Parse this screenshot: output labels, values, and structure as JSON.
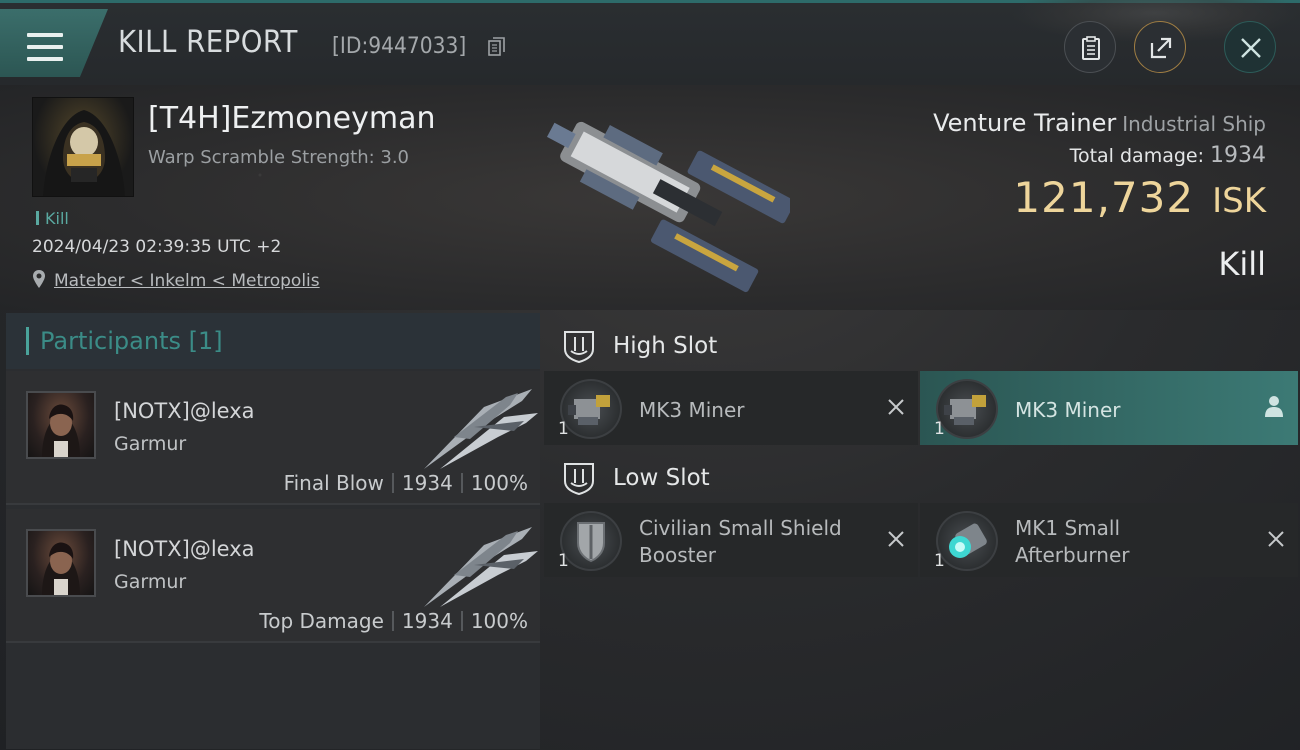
{
  "header": {
    "title": "KILL REPORT",
    "report_id": "[ID:9447033]"
  },
  "victim": {
    "name": "[T4H]Ezmoneyman",
    "warp_scramble": "Warp Scramble Strength: 3.0",
    "tag": "Kill",
    "datetime": "2024/04/23 02:39:35 UTC +2",
    "location": "Mateber < Inkelm < Metropolis",
    "ship_name": "Venture Trainer",
    "ship_class": "Industrial Ship",
    "total_damage_label": "Total damage:",
    "total_damage": "1934",
    "isk_value": "121,732",
    "isk_currency": "ISK",
    "result": "Kill"
  },
  "participants": {
    "title": "Participants [1]",
    "items": [
      {
        "name": "[NOTX]@lexa",
        "ship": "Garmur",
        "role": "Final Blow",
        "damage": "1934",
        "percent": "100%"
      },
      {
        "name": "[NOTX]@lexa",
        "ship": "Garmur",
        "role": "Top Damage",
        "damage": "1934",
        "percent": "100%"
      }
    ]
  },
  "fitting": {
    "high_slot": {
      "label": "High Slot",
      "modules": [
        {
          "name": "MK3 Miner",
          "qty": "1"
        },
        {
          "name": "MK3 Miner",
          "qty": "1"
        }
      ]
    },
    "low_slot": {
      "label": "Low Slot",
      "modules": [
        {
          "name_line1": "Civilian Small Shield",
          "name_line2": "Booster",
          "qty": "1"
        },
        {
          "name_line1": "MK1 Small",
          "name_line2": "Afterburner",
          "qty": "1"
        }
      ]
    }
  },
  "colors": {
    "accent": "#3b8c87",
    "isk": "#eed59b",
    "active_module": "#3c7a75"
  },
  "icons": [
    "menu-icon",
    "copy-icon",
    "clipboard-icon",
    "share-icon",
    "close-icon",
    "location-pin-icon",
    "high-slot-icon",
    "low-slot-icon",
    "miner-icon",
    "shield-booster-icon",
    "afterburner-icon",
    "remove-icon",
    "person-icon"
  ]
}
